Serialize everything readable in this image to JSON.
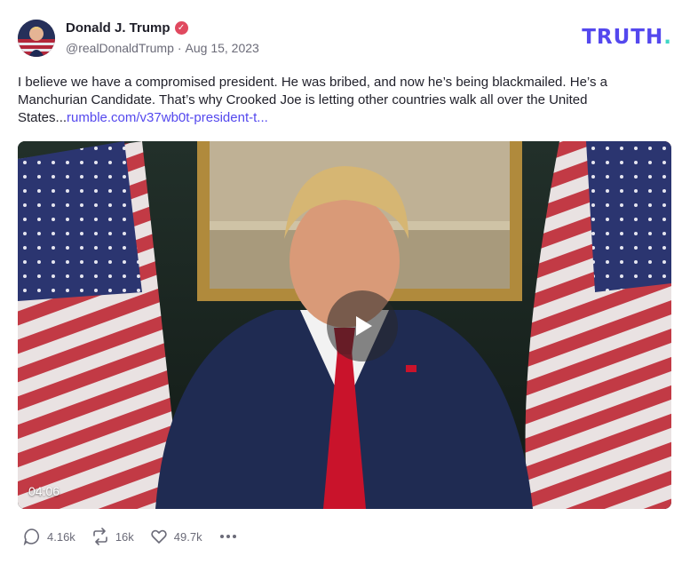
{
  "post": {
    "author_name": "Donald J. Trump",
    "handle": "@realDonaldTrump",
    "separator": "·",
    "date": "Aug 15, 2023",
    "text": "I believe we have a compromised president. He was bribed, and now he’s being blackmailed. He’s a Manchurian Candidate. That’s why Crooked Joe is letting other countries walk all over the United States...",
    "link_text": "rumble.com/v37wb0t-president-t..."
  },
  "brand": {
    "logo_text": "TRUTH",
    "logo_dot": ".",
    "accent_color": "#5448ee",
    "dot_color": "#3fd6c5",
    "verified_color": "#e0495f"
  },
  "video": {
    "duration": "04:06"
  },
  "actions": {
    "replies": "4.16k",
    "retruths": "16k",
    "likes": "49.7k",
    "more_icon": "more-horizontal-icon"
  }
}
